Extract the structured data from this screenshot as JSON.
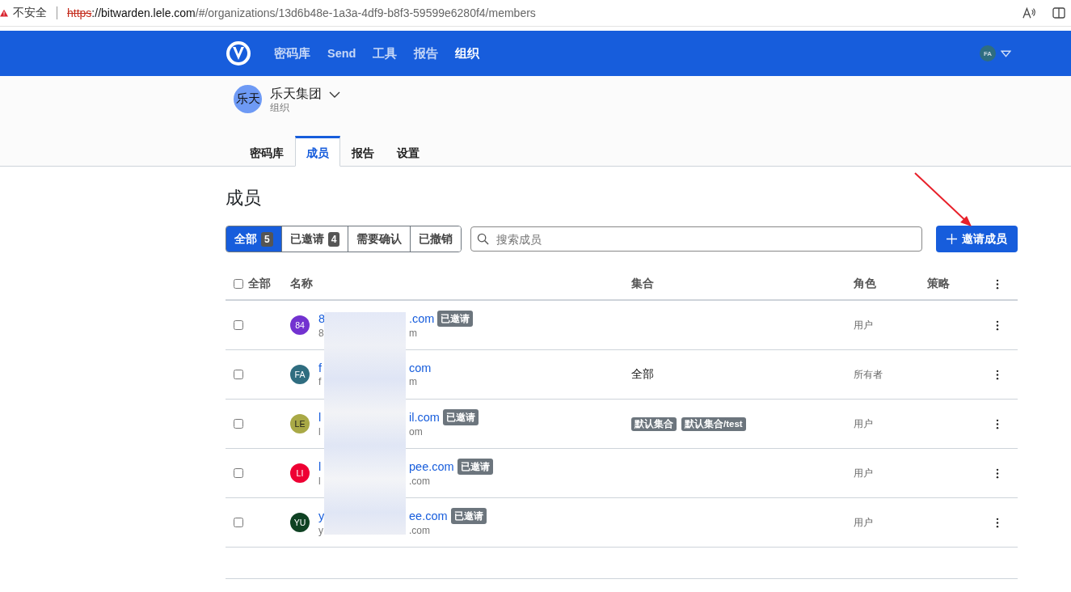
{
  "browser": {
    "security_label": "不安全",
    "url": {
      "scheme": "https",
      "host": "://bitwarden.lele.com",
      "path": "/#/organizations/13d6b48e-1a3a-4df9-b8f3-59599e6280f4/members"
    }
  },
  "navbar": {
    "items": [
      {
        "label": "密码库",
        "selected": false
      },
      {
        "label": "Send",
        "selected": false
      },
      {
        "label": "工具",
        "selected": false
      },
      {
        "label": "报告",
        "selected": false
      },
      {
        "label": "组织",
        "selected": true
      }
    ],
    "account": {
      "initials": "FA"
    }
  },
  "organization": {
    "avatar": "乐天",
    "name": "乐天集团",
    "type": "组织"
  },
  "org_tabs": [
    {
      "label": "密码库",
      "selected": false
    },
    {
      "label": "成员",
      "selected": true
    },
    {
      "label": "报告",
      "selected": false
    },
    {
      "label": "设置",
      "selected": false
    }
  ],
  "page_title": "成员",
  "filters": [
    {
      "label": "全部",
      "count": "5",
      "selected": true
    },
    {
      "label": "已邀请",
      "count": "4",
      "selected": false
    },
    {
      "label": "需要确认",
      "selected": false
    },
    {
      "label": "已撤销",
      "selected": false
    }
  ],
  "search": {
    "placeholder": "搜索成员"
  },
  "invite_button": {
    "label": "邀请成员"
  },
  "table": {
    "select_all": {
      "label": "全部",
      "checked": false
    },
    "columns": [
      "名称",
      "集合",
      "角色",
      "策略"
    ],
    "rows": [
      {
        "checked": false,
        "avatar": "84",
        "color": "#7232d0",
        "name_start": "8",
        "name_end": ".com",
        "email_start": "8",
        "email_end": "m",
        "badge": "已邀请",
        "collections": [],
        "role": "用户"
      },
      {
        "checked": false,
        "avatar": "FA",
        "color": "#2f6d80",
        "name_start": "f",
        "name_end": "com",
        "email_start": "f",
        "email_end": "m",
        "collections": [
          {
            "kind": "text",
            "label": "全部"
          }
        ],
        "role": "所有者"
      },
      {
        "checked": false,
        "avatar": "LE",
        "color": "#a9a946",
        "name_start": "l",
        "name_end": "il.com",
        "email_start": "l",
        "email_end": "om",
        "badge": "已邀请",
        "collections": [
          {
            "kind": "tag",
            "label": "默认集合"
          },
          {
            "kind": "tag",
            "label": "默认集合/test"
          }
        ],
        "role": "用户"
      },
      {
        "checked": false,
        "avatar": "LI",
        "color": "#ee0033",
        "name_start": "l",
        "name_end": "pee.com",
        "email_start": "l",
        "email_end": ".com",
        "badge": "已邀请",
        "collections": [],
        "role": "用户"
      },
      {
        "checked": false,
        "avatar": "YU",
        "color": "#0f4223",
        "name_start": "y",
        "name_end": "ee.com",
        "email_start": "y",
        "email_end": ".com",
        "badge": "已邀请",
        "collections": [],
        "role": "用户"
      }
    ]
  }
}
